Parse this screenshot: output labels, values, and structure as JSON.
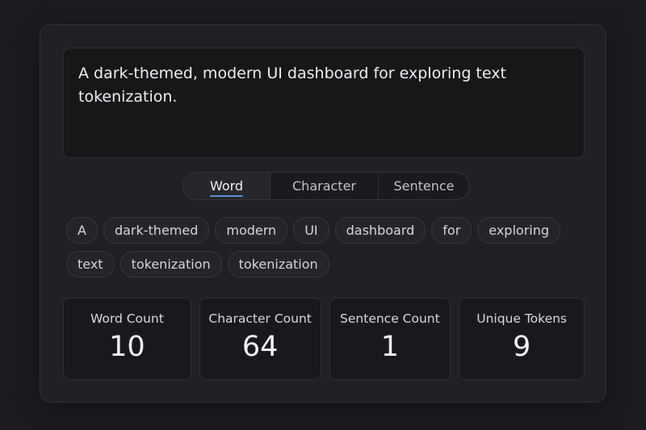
{
  "input": {
    "text": "A dark-themed, modern UI dashboard for exploring text tokenization."
  },
  "tabs": [
    {
      "label": "Word",
      "active": true
    },
    {
      "label": "Character",
      "active": false
    },
    {
      "label": "Sentence",
      "active": false
    }
  ],
  "tokens": [
    "A",
    "dark-themed",
    "modern",
    "UI",
    "dashboard",
    "for",
    "exploring",
    "text",
    "tokenization",
    "tokenization"
  ],
  "stats": [
    {
      "label": "Word Count",
      "value": "10"
    },
    {
      "label": "Character Count",
      "value": "64"
    },
    {
      "label": "Sentence Count",
      "value": "1"
    },
    {
      "label": "Unique Tokens",
      "value": "9"
    }
  ],
  "colors": {
    "background": "#1b1c1f",
    "panel": "#202124",
    "accent": "#5b8fd6"
  }
}
